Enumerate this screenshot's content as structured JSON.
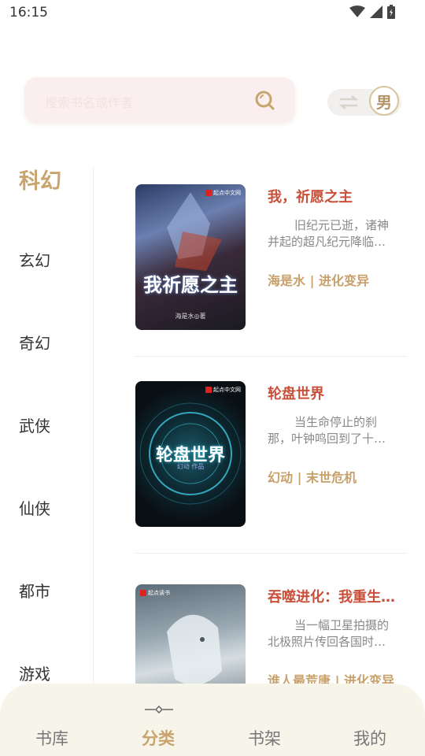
{
  "status_bar": {
    "time": "16:15"
  },
  "search": {
    "placeholder": "搜索书名或作者"
  },
  "gender": {
    "label": "男"
  },
  "categories": [
    {
      "label": "科幻"
    },
    {
      "label": "玄幻"
    },
    {
      "label": "奇幻"
    },
    {
      "label": "武侠"
    },
    {
      "label": "仙侠"
    },
    {
      "label": "都市"
    },
    {
      "label": "游戏"
    }
  ],
  "books": [
    {
      "title": "我，祈愿之主",
      "desc_line1": "旧纪元已逝，诸神",
      "desc_line2": "并起的超凡纪元降临…",
      "meta": "海是水 | 进化变异",
      "cover_title": "我祈愿之主",
      "cover_author": "海是水◎著",
      "cover_badge": "起点中文网"
    },
    {
      "title": "轮盘世界",
      "desc_line1": "当生命停止的刹",
      "desc_line2": "那，叶钟鸣回到了十…",
      "meta": "幻动 | 末世危机",
      "cover_title": "轮盘世界",
      "cover_author": "幻动  作品",
      "cover_badge": "起点中文网"
    },
    {
      "title": "吞噬进化：我重生…",
      "desc_line1": "当一幅卫星拍摄的",
      "desc_line2": "北极照片传回各国时…",
      "meta": "谁人最荒唐 | 进化变异",
      "cover_title": "",
      "cover_author": "",
      "cover_badge": "起点读书"
    }
  ],
  "nav": [
    {
      "label": "书库"
    },
    {
      "label": "分类"
    },
    {
      "label": "书架"
    },
    {
      "label": "我的"
    }
  ],
  "colors": {
    "accent": "#c8a46f",
    "title_red": "#c9503a",
    "nav_bg": "#f7f4ea",
    "search_bg": "#fbeeee"
  }
}
